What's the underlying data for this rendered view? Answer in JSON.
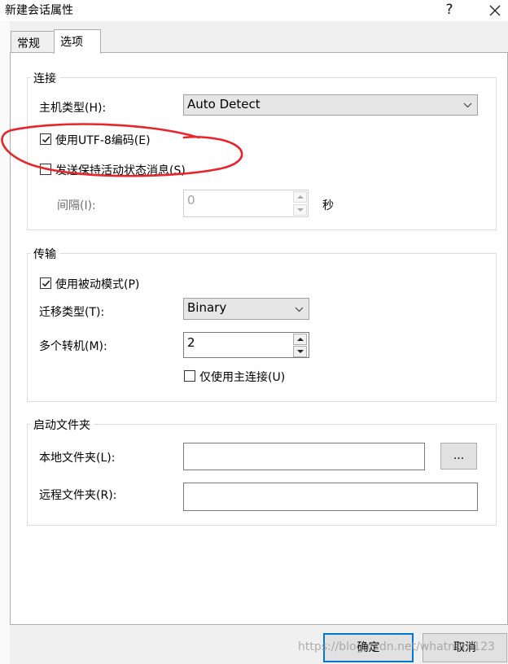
{
  "window": {
    "title": "新建会话属性",
    "help_glyph": "?",
    "close_glyph": "✕"
  },
  "tabs": [
    {
      "label": "常规",
      "active": false
    },
    {
      "label": "选项",
      "active": true
    }
  ],
  "connection": {
    "title": "连接",
    "host_type_label": "主机类型(H):",
    "host_type_value": "Auto Detect",
    "utf8_label": "使用UTF-8编码(E)",
    "utf8_checked": true,
    "keepalive_label": "发送保持活动状态消息(S)",
    "keepalive_checked": false,
    "interval_label": "间隔(I):",
    "interval_value": "0",
    "interval_unit": "秒"
  },
  "transfer": {
    "title": "传输",
    "passive_label": "使用被动模式(P)",
    "passive_checked": true,
    "transfer_type_label": "迁移类型(T):",
    "transfer_type_value": "Binary",
    "multi_host_label": "多个转机(M):",
    "multi_host_value": "2",
    "primary_only_label": "仅使用主连接(U)",
    "primary_only_checked": false
  },
  "startup": {
    "title": "启动文件夹",
    "local_label": "本地文件夹(L):",
    "local_value": "",
    "browse_label": "...",
    "remote_label": "远程文件夹(R):",
    "remote_value": ""
  },
  "footer": {
    "ok_label": "确定",
    "cancel_label": "取消"
  },
  "watermark": "https://blog.csdn.net/whatnam123",
  "colors": {
    "annotation_stroke": "#e8252a",
    "default_button_border": "#0078d7"
  }
}
